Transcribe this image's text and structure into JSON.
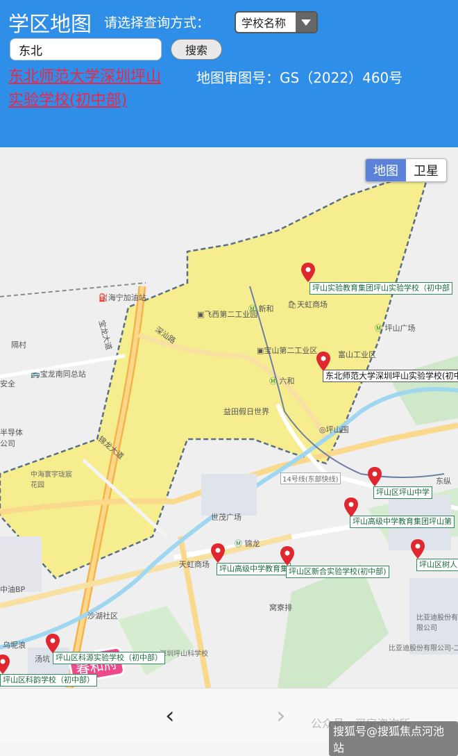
{
  "header": {
    "title": "学区地图",
    "query_mode_label": "请选择查询方式：",
    "query_mode_selected": "学校名称",
    "search_value": "东北",
    "search_button": "搜索",
    "result_link": "东北师范大学深圳坪山实验学校(初中部)",
    "map_approval": "地图审图号：GS（2022）460号",
    "bg_color": "#2f8ee8"
  },
  "map_toggle": {
    "map": "地图",
    "satellite": "卫星",
    "active": "地图"
  },
  "school_markers": [
    {
      "name": "坪山实验教育集团坪山实验学校（初中部"
    },
    {
      "name": "东北师范大学深圳坪山实验学校(初中"
    },
    {
      "name": "坪山区坪山中学"
    },
    {
      "name": "坪山高级中学教育集团坪山第"
    },
    {
      "name": "坪山高级中学教育集"
    },
    {
      "name": "坪山区新合实验学校(初中部)"
    },
    {
      "name": "坪山区树人"
    },
    {
      "name": "坪山区科源实验学校（初中部）"
    },
    {
      "name": "坪山区科韵学校（初中部）"
    }
  ],
  "poi": {
    "haining": "海宁加油站",
    "feixi": "飞西第二工业园",
    "xinhe": "新和",
    "tianhong1": "天虹商场",
    "pingshan_square": "坪山广场",
    "baoshan": "宝山第二工业区",
    "fushan": "富山工业区",
    "liuhe": "六和",
    "yitian": "益田假日世界",
    "pingshanwei": "坪山围",
    "shenshan": "深汕路",
    "baolong_road": "宝龙大道",
    "geli": "隔村",
    "baolong_nantong": "宝龙南同总站",
    "an": "安全",
    "semi": "半导体",
    "company": "公司",
    "jinlong": "锦龙大道",
    "zhonghai": "中海寰宇珑宸花园",
    "line14": "14号线(东部快线)",
    "shimao": "世茂广场",
    "jinlong2": "锦龙",
    "tianhong2": "天虹商场",
    "oil": "中油BP",
    "shahu": "沙湖社区",
    "wuni": "乌坭浪",
    "tangkeng": "汤坑",
    "kewu": "深圳坪山科学校",
    "wolaopai": "窝寮排",
    "byd1": "比亚迪股份有限公司",
    "byd2": "比亚迪股份有限公司-二期",
    "dong": "东纵",
    "ping": "坪"
  },
  "chunhefu": "春和府",
  "bottom_bar": {
    "prev": "‹",
    "next": "›",
    "watermark_gzh": "公众号 · 买房咨询所",
    "watermark_sohu": "搜狐号@搜狐焦点河池站"
  },
  "colors": {
    "district_fill": "#f6ee86",
    "district_border": "#5a6f86",
    "pin": "#e0262e"
  }
}
